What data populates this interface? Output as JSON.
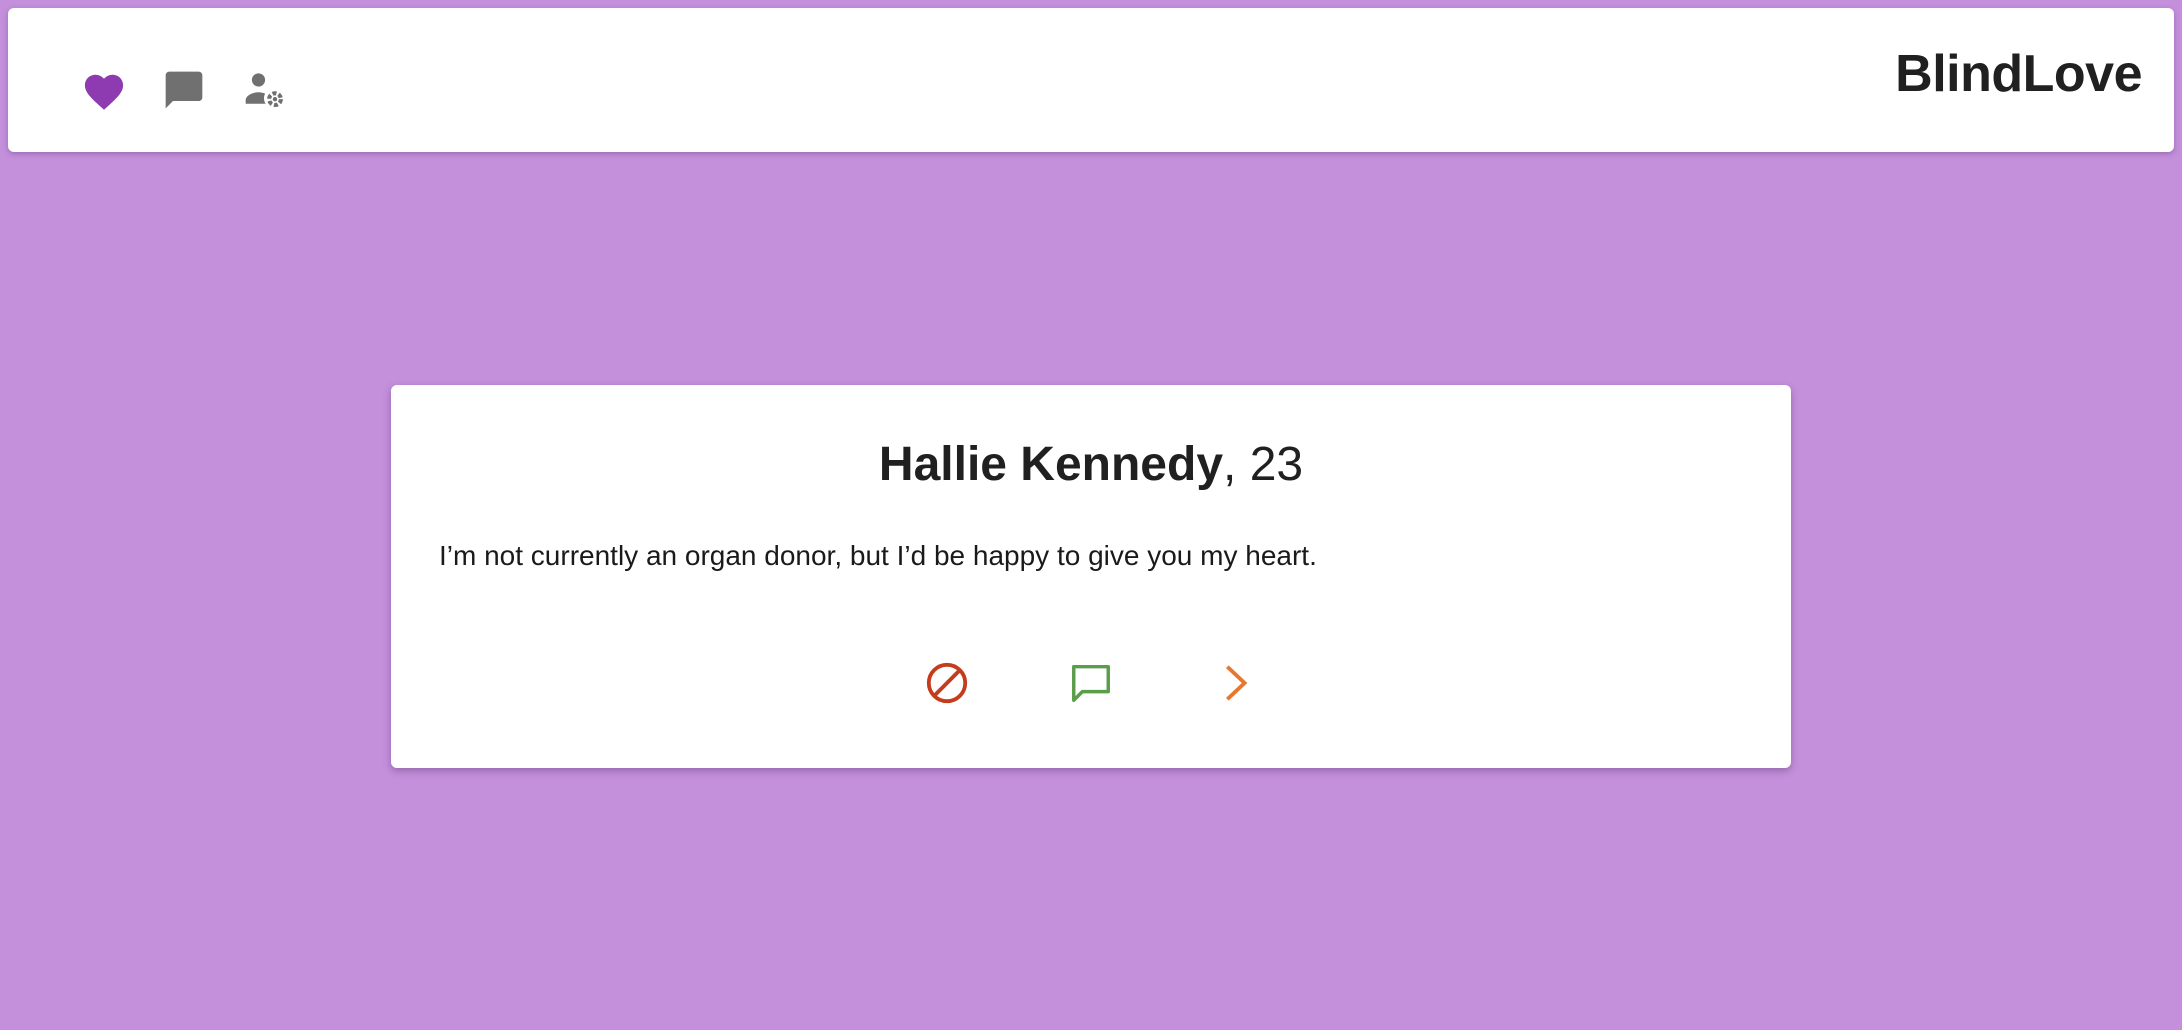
{
  "header": {
    "brand": "BlindLove",
    "nav": [
      {
        "icon": "heart-icon",
        "active": true,
        "color": "#8e3ab0"
      },
      {
        "icon": "chat-icon",
        "active": false,
        "color": "#707070"
      },
      {
        "icon": "user-settings-icon",
        "active": false,
        "color": "#707070"
      }
    ]
  },
  "profile": {
    "name": "Hallie Kennedy",
    "age_separator": ", ",
    "age": "23",
    "bio": "I’m not currently an organ donor, but I’d be happy to give you my heart."
  },
  "actions": [
    {
      "icon": "block-icon",
      "color": "#c43c1c"
    },
    {
      "icon": "message-icon",
      "color": "#5a9e4c"
    },
    {
      "icon": "next-chevron-icon",
      "color": "#e8762c"
    }
  ],
  "colors": {
    "background": "#c490dc",
    "surface": "#ffffff",
    "accent": "#8e3ab0"
  }
}
